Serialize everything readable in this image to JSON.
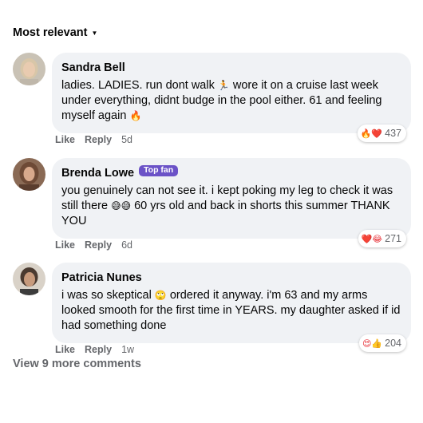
{
  "sort": {
    "label": "Most relevant",
    "caret": "▼"
  },
  "comments": [
    {
      "name": "Sandra Bell",
      "badge": "",
      "text_before_emoji": "ladies. LADIES. run dont walk ",
      "emoji_1": "🏃",
      "text_middle": " wore it on a cruise last week under everything, didnt budge in the pool either. 61 and feeling myself again ",
      "emoji_2": "🔥",
      "reaction_emojis": "🔥❤️",
      "reaction_count": "437",
      "like": "Like",
      "reply": "Reply",
      "time": "5d"
    },
    {
      "name": "Brenda Lowe",
      "badge": "Top fan",
      "text_before_emoji": "you genuinely can not see it. i kept poking my leg to check it was still there ",
      "emoji_1": "😅😅",
      "text_middle": " 60 yrs old and back in shorts this summer THANK YOU",
      "emoji_2": "",
      "reaction_emojis": "❤️😂",
      "reaction_count": "271",
      "like": "Like",
      "reply": "Reply",
      "time": "6d"
    },
    {
      "name": "Patricia Nunes",
      "badge": "",
      "text_before_emoji": "i was so skeptical ",
      "emoji_1": "🙄",
      "text_middle": " ordered it anyway. i'm 63 and my arms looked smooth for the first time in YEARS. my daughter asked if id had something done",
      "emoji_2": "",
      "reaction_emojis": "😍👍",
      "reaction_count": "204",
      "like": "Like",
      "reply": "Reply",
      "time": "1w"
    }
  ],
  "view_more": "View 9 more comments",
  "colors": {
    "bubble": "#f0f2f5",
    "badge": "#6b52c7",
    "muted": "#65676b"
  },
  "icons": {
    "avatar": "avatar-photo",
    "caret": "caret-down-icon"
  }
}
